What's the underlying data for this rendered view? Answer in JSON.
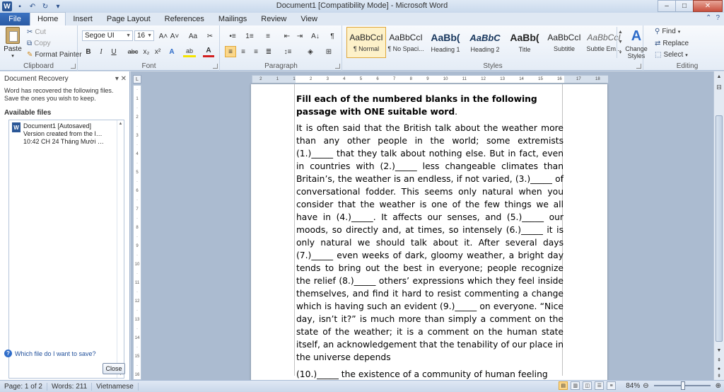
{
  "window": {
    "title": "Document1 [Compatibility Mode] - Microsoft Word",
    "controls": [
      "–",
      "□",
      "✕"
    ]
  },
  "quick_access": [
    "W",
    "💾",
    "↶",
    "↷",
    "▾"
  ],
  "tabs": {
    "file": "File",
    "items": [
      "Home",
      "Insert",
      "Page Layout",
      "References",
      "Mailings",
      "Review",
      "View"
    ],
    "active": "Home"
  },
  "ribbon": {
    "clipboard": {
      "label": "Clipboard",
      "paste": "Paste",
      "cut": "Cut",
      "copy": "Copy",
      "format_painter": "Format Painter"
    },
    "font": {
      "label": "Font",
      "name": "Segoe UI",
      "size": "16",
      "grow": "A˄",
      "shrink": "A˅",
      "case": "Aa",
      "clear": "✂",
      "bold": "B",
      "italic": "I",
      "underline": "U",
      "strike": "abc",
      "subscript": "x₂",
      "superscript": "x²",
      "effects": "A",
      "highlight": "ab",
      "font_color": "A"
    },
    "paragraph": {
      "label": "Paragraph",
      "bullets": "•≡",
      "numbering": "1≡",
      "multilevel": "≡",
      "decrease": "⇤",
      "increase": "⇥",
      "sort": "A↓",
      "pilcrow": "¶"
    },
    "styles": {
      "label": "Styles",
      "items": [
        {
          "preview": "AaBbCcI",
          "name": "¶ Normal"
        },
        {
          "preview": "AaBbCcI",
          "name": "¶ No Spaci..."
        },
        {
          "preview": "AaBb(",
          "name": "Heading 1"
        },
        {
          "preview": "AaBbC",
          "name": "Heading 2"
        },
        {
          "preview": "AaBb(",
          "name": "Title"
        },
        {
          "preview": "AaBbCcI",
          "name": "Subtitle"
        },
        {
          "preview": "AaBbCcI",
          "name": "Subtle Em..."
        }
      ],
      "change_styles": "Change Styles"
    },
    "editing": {
      "label": "Editing",
      "find": "Find",
      "replace": "Replace",
      "select": "Select"
    }
  },
  "recovery_pane": {
    "title": "Document Recovery",
    "message": "Word has recovered the following files.  Save the ones you wish to keep.",
    "available": "Available files",
    "file": {
      "name": "Document1  [Autosaved]",
      "line2": "Version created from the last ...",
      "line3": "10:42 CH 24 Tháng Mười Hai ..."
    },
    "help": "Which file do I want to save?",
    "close": "Close"
  },
  "document": {
    "heading_bold": "Fill each of the numbered blanks in the following passage with ONE suitable word",
    "heading_tail": ".",
    "paragraph": "It is often said that the British talk about the weather more than any other people in the world; some extremists (1.)_____ that they talk about nothing else. But in fact, even in countries with (2.)_____ less changeable climates than Britain’s, the weather is an endless, if not varied, (3.)_____ of conversational fodder. This seems only natural when you consider that the weather is one of the few things we all have in (4.)_____. It affects our senses, and (5.)_____ our moods, so directly and, at times, so intensely (6.)_____ it is only natural we should talk about it. After several days (7.)_____ even weeks of dark, gloomy weather, a bright day tends to bring out the best in everyone; people recognize the relief (8.)_____ others’ expressions which they feel inside themselves, and find it hard to resist commenting a change which is having such an evident (9.)_____ on everyone. “Nice day, isn’t it?” is much more than simply a comment on the state of the weather; it is a comment on the human state itself, an acknowledgement that the tenability of our place in the universe depends",
    "paragraph2": "(10.)_____ the existence of a community of human feeling"
  },
  "ruler": [
    "2",
    "1",
    "1",
    "2",
    "3",
    "4",
    "5",
    "6",
    "7",
    "8",
    "9",
    "10",
    "11",
    "12",
    "13",
    "14",
    "15",
    "16",
    "17",
    "18"
  ],
  "statusbar": {
    "page": "Page: 1 of 2",
    "words": "Words: 211",
    "language": "Vietnamese",
    "zoom": "84%"
  }
}
